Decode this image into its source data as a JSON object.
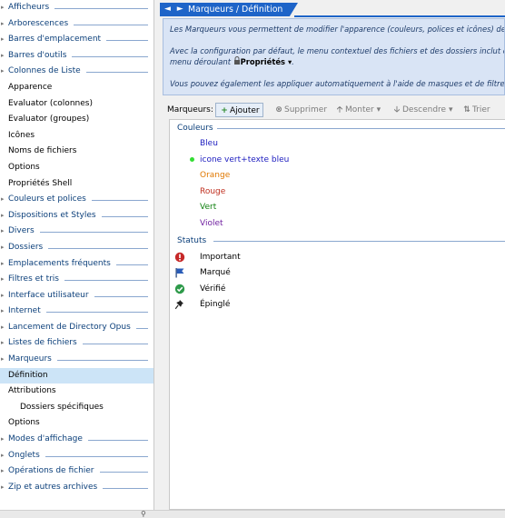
{
  "tree": [
    {
      "label": "Afficheurs",
      "kind": "section"
    },
    {
      "label": "Arborescences",
      "kind": "section"
    },
    {
      "label": "Barres d'emplacement",
      "kind": "section"
    },
    {
      "label": "Barres d'outils",
      "kind": "section"
    },
    {
      "label": "Colonnes de Liste",
      "kind": "section"
    },
    {
      "label": "Apparence",
      "kind": "item"
    },
    {
      "label": "Evaluator (colonnes)",
      "kind": "item"
    },
    {
      "label": "Evaluator (groupes)",
      "kind": "item"
    },
    {
      "label": "Icônes",
      "kind": "item"
    },
    {
      "label": "Noms de fichiers",
      "kind": "item"
    },
    {
      "label": "Options",
      "kind": "item"
    },
    {
      "label": "Propriétés Shell",
      "kind": "item"
    },
    {
      "label": "Couleurs et polices",
      "kind": "section"
    },
    {
      "label": "Dispositions et Styles",
      "kind": "section"
    },
    {
      "label": "Divers",
      "kind": "section"
    },
    {
      "label": "Dossiers",
      "kind": "section"
    },
    {
      "label": "Emplacements fréquents",
      "kind": "section"
    },
    {
      "label": "Filtres et tris",
      "kind": "section"
    },
    {
      "label": "Interface utilisateur",
      "kind": "section"
    },
    {
      "label": "Internet",
      "kind": "section"
    },
    {
      "label": "Lancement de Directory Opus",
      "kind": "section"
    },
    {
      "label": "Listes de fichiers",
      "kind": "section"
    },
    {
      "label": "Marqueurs",
      "kind": "section"
    },
    {
      "label": "Définition",
      "kind": "item",
      "selected": true
    },
    {
      "label": "Attributions",
      "kind": "item"
    },
    {
      "label": "Dossiers spécifiques",
      "kind": "subitem"
    },
    {
      "label": "Options",
      "kind": "item"
    },
    {
      "label": "Modes d'affichage",
      "kind": "section"
    },
    {
      "label": "Onglets",
      "kind": "section"
    },
    {
      "label": "Opérations de fichier",
      "kind": "section"
    },
    {
      "label": "Zip et autres archives",
      "kind": "section"
    }
  ],
  "header": {
    "title": "Marqueurs / Définition",
    "nav": "◄ ►"
  },
  "info": {
    "line1": "Les Marqueurs vous permettent de modifier l'apparence (couleurs, polices et icônes) de fi",
    "line2": "Avec la configuration par défaut, le menu contextuel des fichiers et des dossiers inclut des",
    "line3_prefix": "menu déroulant ",
    "line3_prop": "Propriétés",
    "line3_suffix": ".",
    "line4": "Vous pouvez également les appliquer automatiquement à l'aide de masques et de filtres"
  },
  "toolbar": {
    "label": "Marqueurs:",
    "add": "Ajouter",
    "delete": "Supprimer",
    "up": "Monter",
    "down": "Descendre",
    "sort": "Trier"
  },
  "list": {
    "group_colors": "Couleurs",
    "colors": [
      {
        "label": "Bleu",
        "color": "#2020c0"
      },
      {
        "label": "icone vert+texte bleu",
        "color": "#2020c0"
      },
      {
        "label": "Orange",
        "color": "#e07800"
      },
      {
        "label": "Rouge",
        "color": "#c03020"
      },
      {
        "label": "Vert",
        "color": "#108010"
      },
      {
        "label": "Violet",
        "color": "#7020a0"
      }
    ],
    "group_status": "Statuts",
    "status": [
      {
        "label": "Important",
        "icon": "exclamation-icon"
      },
      {
        "label": "Marqué",
        "icon": "flag-icon"
      },
      {
        "label": "Vérifié",
        "icon": "check-icon"
      },
      {
        "label": "Épinglé",
        "icon": "pin-icon"
      }
    ]
  }
}
